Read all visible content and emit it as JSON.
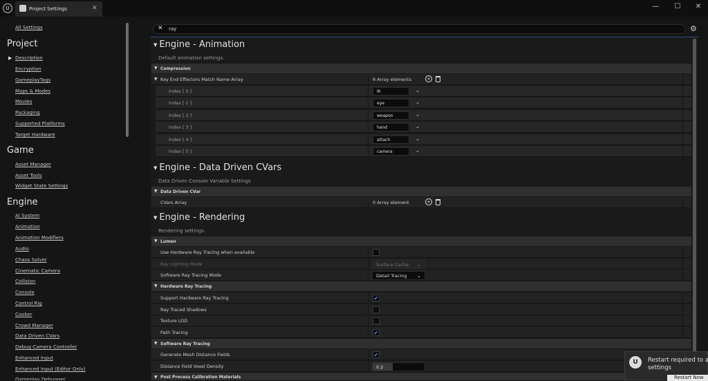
{
  "window": {
    "tab_title": "Project Settings",
    "minimize": "—",
    "maximize": "☐",
    "close": "✕",
    "tab_close": "✕"
  },
  "sidebar": {
    "all_settings": "All Settings",
    "groups": [
      {
        "title": "Project",
        "items": [
          "Description",
          "Encryption",
          "GameplayTags",
          "Maps & Modes",
          "Movies",
          "Packaging",
          "Supported Platforms",
          "Target Hardware"
        ]
      },
      {
        "title": "Game",
        "items": [
          "Asset Manager",
          "Asset Tools",
          "Widget State Settings"
        ]
      },
      {
        "title": "Engine",
        "items": [
          "AI System",
          "Animation",
          "Animation Modifiers",
          "Audio",
          "Chaos Solver",
          "Cinematic Camera",
          "Collision",
          "Console",
          "Control Rig",
          "Cooker",
          "Crowd Manager",
          "Data Driven CVars",
          "Debug Camera Controller",
          "Enhanced Input",
          "Enhanced Input (Editor Only)",
          "Gameplay Debugger"
        ]
      }
    ]
  },
  "search": {
    "value": "ray",
    "clear": "✕"
  },
  "sections": {
    "animation": {
      "title": "Engine - Animation",
      "desc": "Default animation settings.",
      "category": "Compression",
      "array_name": "Key End Effectors Match Name Array",
      "array_count": "6 Array elements",
      "elements": [
        {
          "index": "Index [ 0 ]",
          "value": "IK"
        },
        {
          "index": "Index [ 1 ]",
          "value": "eye"
        },
        {
          "index": "Index [ 2 ]",
          "value": "weapon"
        },
        {
          "index": "Index [ 3 ]",
          "value": "hand"
        },
        {
          "index": "Index [ 4 ]",
          "value": "attach"
        },
        {
          "index": "Index [ 5 ]",
          "value": "camera"
        }
      ]
    },
    "cvars": {
      "title": "Engine - Data Driven CVars",
      "desc": "Data Driven Console Variable Settings",
      "category": "Data Driven CVar",
      "array_name": "CVars Array",
      "array_count": "0 Array element"
    },
    "rendering": {
      "title": "Engine - Rendering",
      "desc": "Rendering settings.",
      "lumen": {
        "category": "Lumen",
        "hw_rt_label": "Use Hardware Ray Tracing when available",
        "hw_rt_checked": false,
        "lighting_mode_label": "Ray Lighting Mode",
        "lighting_mode_value": "Surface Cache",
        "sw_mode_label": "Software Ray Tracing Mode",
        "sw_mode_value": "Detail Tracing"
      },
      "hwrt": {
        "category": "Hardware Ray Tracing",
        "items": [
          {
            "label": "Support Hardware Ray Tracing",
            "checked": true
          },
          {
            "label": "Ray Traced Shadows",
            "checked": false
          },
          {
            "label": "Texture LOD",
            "checked": false
          },
          {
            "label": "Path Tracing",
            "checked": true
          }
        ]
      },
      "swrt": {
        "category": "Software Ray Tracing",
        "gen_label": "Generate Mesh Distance Fields",
        "gen_checked": true,
        "density_label": "Distance Field Voxel Density",
        "density_value": "0.2"
      },
      "post": {
        "category": "Post Process Calibration Materials"
      }
    }
  },
  "toast": {
    "message_line1": "Restart required to a",
    "message_line2": "settings",
    "button": "Restart Now"
  },
  "colors": {
    "accent": "#5b8fd8",
    "panel": "#1a1a1a",
    "category": "#2f2f2f"
  }
}
